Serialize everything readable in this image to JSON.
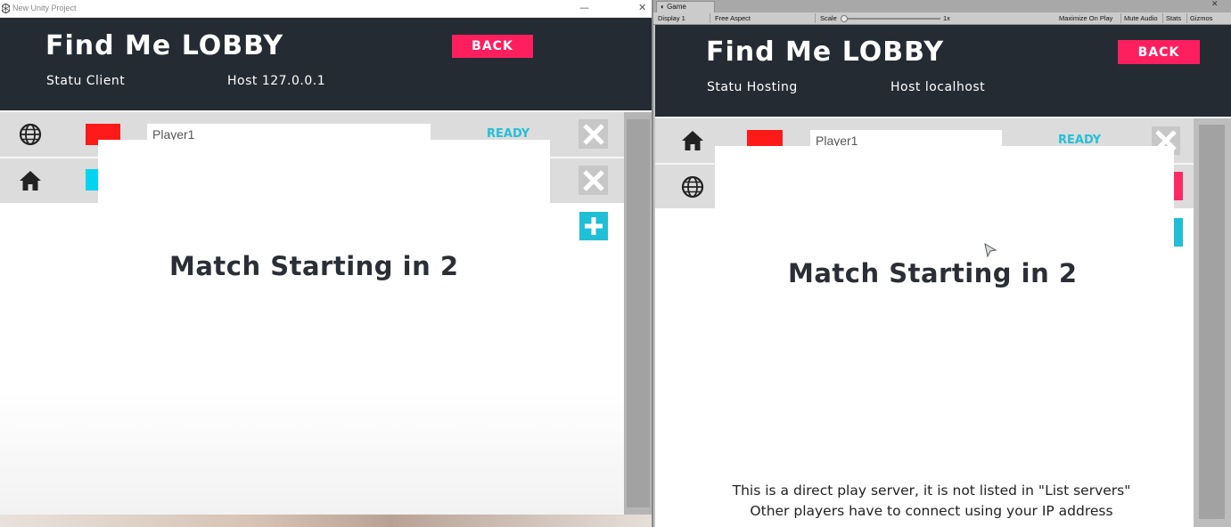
{
  "left_window": {
    "title": "New Unity Project",
    "lobby_title": "Find Me LOBBY",
    "back_label": "BACK",
    "status_text": "Statu Client",
    "host_text": "Host 127.0.0.1",
    "players": [
      {
        "icon": "globe-icon",
        "color": "#ff1a1a",
        "name": "Player1",
        "status": "READY"
      },
      {
        "icon": "home-icon",
        "color": "#00d4f0",
        "name": "",
        "status": ""
      }
    ],
    "match_text": "Match Starting in 2"
  },
  "right_window": {
    "tab_label": "Game",
    "toolbar": {
      "display": "Display 1",
      "aspect": "Free Aspect",
      "scale_label": "Scale",
      "scale_value": "1x",
      "maximize": "Maximize On Play",
      "mute": "Mute Audio",
      "stats": "Stats",
      "gizmos": "Gizmos"
    },
    "lobby_title": "Find Me LOBBY",
    "back_label": "BACK",
    "status_text": "Statu Hosting",
    "host_text": "Host localhost",
    "players": [
      {
        "icon": "home-icon",
        "color": "#ff1a1a",
        "name": "Player1",
        "status": "READY"
      },
      {
        "icon": "globe-icon",
        "color": "",
        "name": "",
        "status": ""
      }
    ],
    "match_text": "Match Starting in 2",
    "footer_line1": "This is a direct play server, it is not listed in \"List servers\"",
    "footer_line2": "Other players have to connect using your IP address"
  },
  "colors": {
    "header_bg": "#242b33",
    "back_button": "#ff1f5f",
    "ready_text": "#26c0d6",
    "plus_button": "#1fbfd6"
  }
}
